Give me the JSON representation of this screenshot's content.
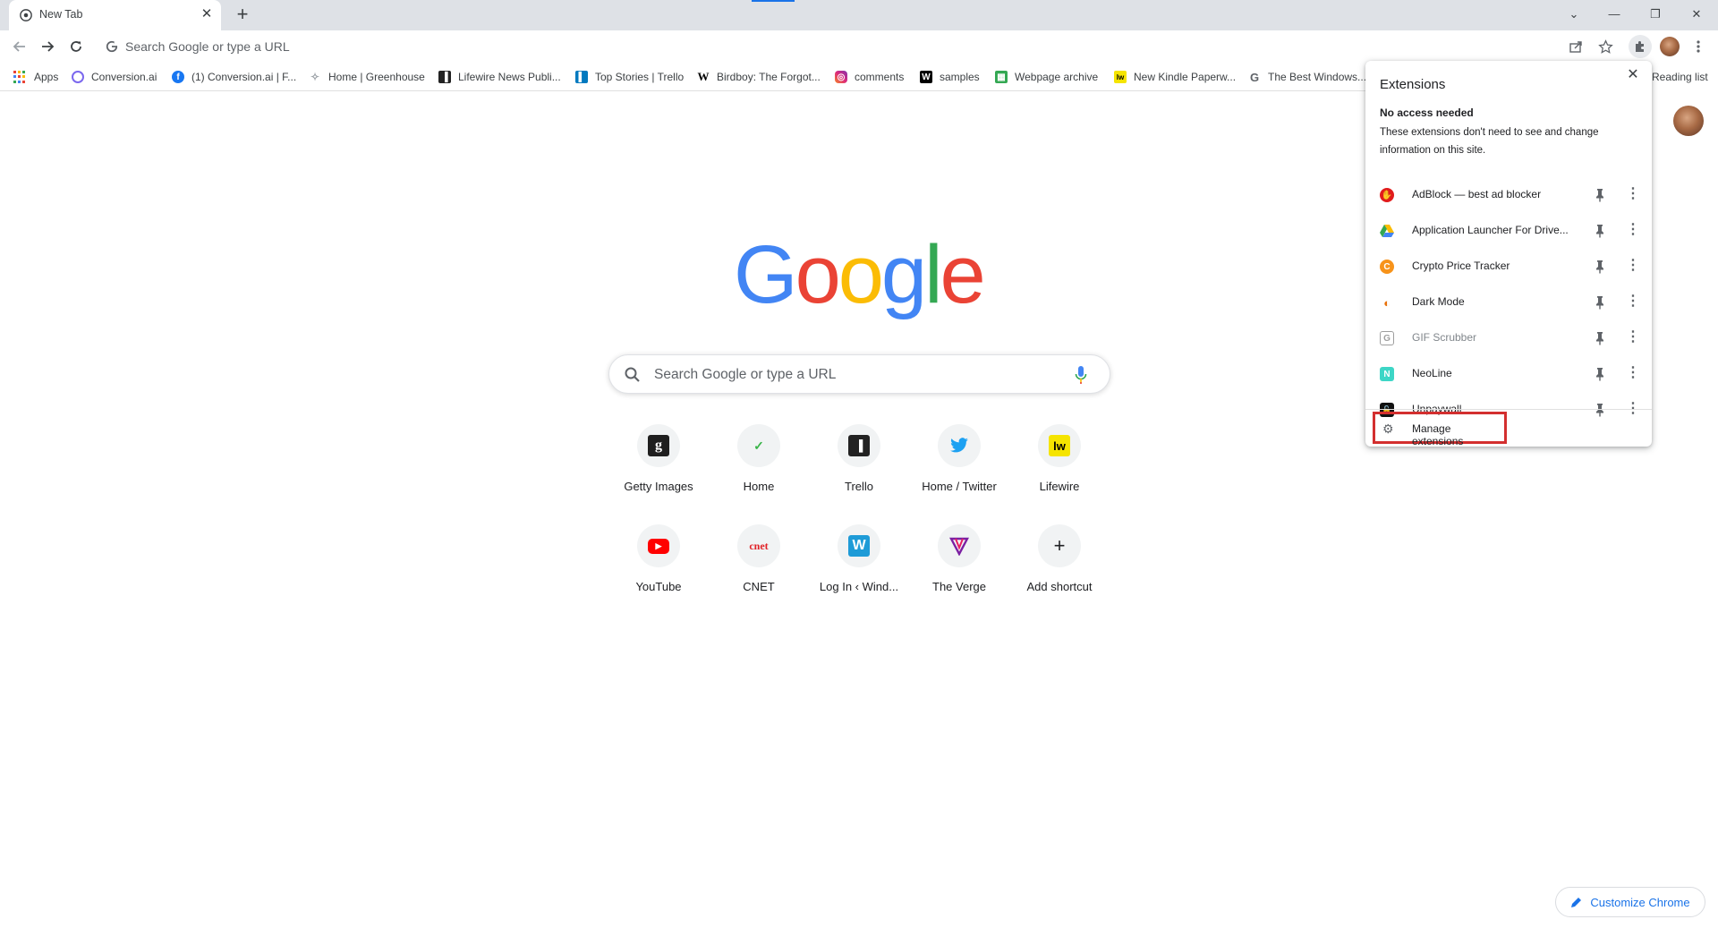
{
  "tab": {
    "title": "New Tab",
    "close": "✕",
    "new_tab": "+"
  },
  "window": {
    "dropdown": "⌄",
    "minimize": "—",
    "restore": "❐",
    "close": "✕"
  },
  "omnibox": {
    "placeholder": "Search Google or type a URL"
  },
  "bookmarks": [
    {
      "label": "Apps",
      "icon": "apps-grid-icon",
      "color": "#4285f4"
    },
    {
      "label": "Conversion.ai",
      "icon": "conversion-icon",
      "color": "#7b68ee"
    },
    {
      "label": "(1) Conversion.ai | F...",
      "icon": "facebook-icon",
      "color": "#1877f2"
    },
    {
      "label": "Home | Greenhouse",
      "icon": "greenhouse-icon",
      "color": "#9aa0a6"
    },
    {
      "label": "Lifewire News Publi...",
      "icon": "trello-icon",
      "color": "#222222"
    },
    {
      "label": "Top Stories | Trello",
      "icon": "trello-icon",
      "color": "#0079bf"
    },
    {
      "label": "Birdboy: The Forgot...",
      "icon": "wikipedia-icon",
      "color": "#000000"
    },
    {
      "label": "comments",
      "icon": "instagram-icon",
      "color": "#e1306c"
    },
    {
      "label": "samples",
      "icon": "w-icon",
      "color": "#000000"
    },
    {
      "label": "Webpage archive",
      "icon": "archive-icon",
      "color": "#34a853"
    },
    {
      "label": "New Kindle Paperw...",
      "icon": "lifewire-icon",
      "color": "#f5e400"
    },
    {
      "label": "The Best Windows...",
      "icon": "g-icon",
      "color": "#5f6368"
    }
  ],
  "reading_list": "Reading list",
  "ntp": {
    "search_placeholder": "Search Google or type a URL",
    "shortcuts": [
      {
        "label": "Getty Images",
        "glyph": "g",
        "icon": "getty-images-icon",
        "color": "#1f1f1f"
      },
      {
        "label": "Home",
        "glyph": "✓",
        "icon": "greenhouse-icon",
        "color": "#3ab549"
      },
      {
        "label": "Trello",
        "glyph": "▐",
        "icon": "trello-icon",
        "color": "#222222"
      },
      {
        "label": "Home / Twitter",
        "glyph": "🐦",
        "icon": "twitter-icon",
        "color": "#1da1f2"
      },
      {
        "label": "Lifewire",
        "glyph": "lw",
        "icon": "lifewire-icon",
        "color": "#f5e400"
      },
      {
        "label": "YouTube",
        "glyph": "▶",
        "icon": "youtube-icon",
        "color": "#ff0000"
      },
      {
        "label": "CNET",
        "glyph": "cnet",
        "icon": "cnet-icon",
        "color": "#e12025"
      },
      {
        "label": "Log In ‹ Wind...",
        "glyph": "W",
        "icon": "w-icon",
        "color": "#1e9bd7"
      },
      {
        "label": "The Verge",
        "glyph": "V",
        "icon": "the-verge-icon",
        "color": "#7b1fa2"
      },
      {
        "label": "Add shortcut",
        "glyph": "+",
        "icon": "plus-icon",
        "color": "#202124"
      }
    ]
  },
  "extensions_popup": {
    "title": "Extensions",
    "close": "✕",
    "section_title": "No access needed",
    "section_desc": "These extensions don't need to see and change information on this site.",
    "items": [
      {
        "name": "AdBlock — best ad blocker",
        "icon": "adblock-icon",
        "color": "#e11c1c",
        "glyph": "✋"
      },
      {
        "name": "Application Launcher For Drive...",
        "icon": "google-drive-icon",
        "color": "#34a853",
        "glyph": "▲"
      },
      {
        "name": "Crypto Price Tracker",
        "icon": "crypto-icon",
        "color": "#f7931a",
        "glyph": "C"
      },
      {
        "name": "Dark Mode",
        "icon": "dark-mode-icon",
        "color": "#e8710a",
        "glyph": "◐"
      },
      {
        "name": "GIF Scrubber",
        "icon": "gif-scrubber-icon",
        "color": "#9e9e9e",
        "glyph": "G"
      },
      {
        "name": "NeoLine",
        "icon": "neoline-icon",
        "color": "#3dd6c6",
        "glyph": "N"
      },
      {
        "name": "Unpaywall",
        "icon": "unpaywall-icon",
        "color": "#111111",
        "glyph": "🔓"
      }
    ],
    "manage_label": "Manage extensions"
  },
  "customize_label": "Customize Chrome",
  "colors": {
    "accent": "#1a73e8",
    "highlight_box": "#d32f2f"
  }
}
